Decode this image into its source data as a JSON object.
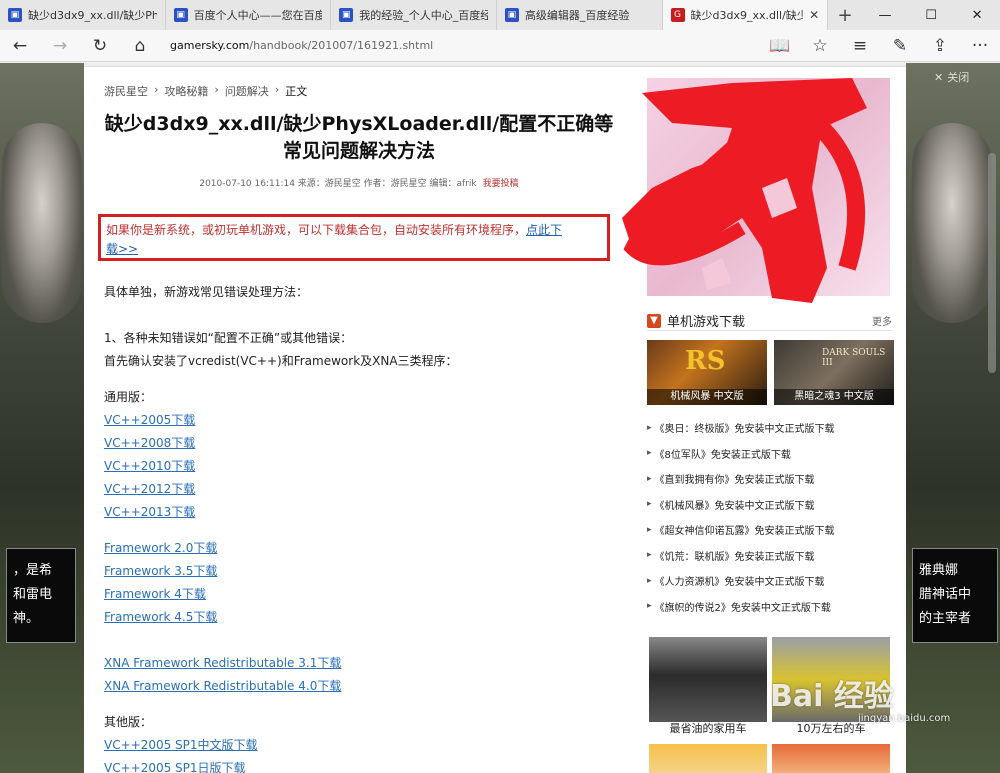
{
  "browser": {
    "tabs": [
      {
        "label": "缺少d3dx9_xx.dll/缺少PhysX",
        "active": false
      },
      {
        "label": "百度个人中心——您在百度",
        "active": false
      },
      {
        "label": "我的经验_个人中心_百度经",
        "active": false
      },
      {
        "label": "高级编辑器_百度经验",
        "active": false
      },
      {
        "label": "缺少d3dx9_xx.dll/缺少P",
        "active": true
      }
    ],
    "new_tab": "+",
    "window_controls": {
      "minimize": "—",
      "maximize": "☐",
      "close": "✕"
    },
    "url_host": "gamersky.com",
    "url_path": "/handbook/201007/161921.shtml",
    "nav_icons": {
      "back": "←",
      "forward": "→",
      "reload": "↻",
      "home": "⌂"
    },
    "toolbar_icons": {
      "reading": "📖",
      "favorite": "☆",
      "hub": "≡",
      "note": "✎",
      "share": "⇪",
      "more": "···"
    }
  },
  "ad": {
    "close_label": "关闭"
  },
  "article": {
    "breadcrumb": [
      "游民星空",
      "攻略秘籍",
      "问题解决",
      "正文"
    ],
    "title_line1": "缺少d3dx9_xx.dll/缺少PhysXLoader.dll/配置不正确等",
    "title_line2": "常见问题解决方法",
    "meta": "2010-07-10 16:11:14 来源：游民星空 作者：游民星空 编辑：afrik",
    "contribute": "我要投稿",
    "notice_text": "如果你是新系统，或初玩单机游戏，可以下载集合包，自动安装所有环境程序，",
    "notice_link_1": "点此下",
    "notice_link_2": "载>>",
    "intro": "具体单独，新游戏常见错误处理方法：",
    "section1_line1": "1、各种未知错误如“配置不正确”或其他错误：",
    "section1_line2": "首先确认安装了vcredist(VC++)和Framework及XNA三类程序：",
    "general_label": "通用版：",
    "vc_links": [
      "VC++2005下载",
      "VC++2008下载",
      "VC++2010下载",
      "VC++2012下载",
      "VC++2013下载"
    ],
    "framework_links": [
      "Framework 2.0下载",
      "Framework 3.5下载",
      "Framework 4下载",
      "Framework 4.5下载"
    ],
    "xna_links": [
      "XNA Framework Redistributable 3.1下载",
      "XNA Framework Redistributable 4.0下载"
    ],
    "other_label": "其他版：",
    "other_links": [
      "VC++2005 SP1中文版下载",
      "VC++2005 SP1日版下载"
    ]
  },
  "sidebar": {
    "section_title": "单机游戏下载",
    "more": "更多",
    "thumbs": [
      {
        "logo": "RS",
        "caption": "机械风暴 中文版"
      },
      {
        "logo": "DARK SOULS III",
        "caption": "黑暗之魂3 中文版"
      }
    ],
    "games": [
      "《奥日：终极版》免安装中文正式版下载",
      "《8位军队》免安装正式版下载",
      "《直到我拥有你》免安装正式版下载",
      "《机械风暴》免安装中文正式版下载",
      "《超女神信仰诺瓦露》免安装正式版下载",
      "《饥荒：联机版》免安装正式版下载",
      "《人力资源机》免安装中文正式版下载",
      "《旗帜的传说2》免安装中文正式版下载"
    ],
    "cars": [
      "最省油的家用车",
      "10万左右的车"
    ]
  },
  "background": {
    "left_promo": "，是希\n和雷电\n神。",
    "right_promo": "雅典娜\n腊神话中\n的主宰者"
  },
  "watermark": {
    "main": "Bai 经验",
    "sub": "jingyan.baidu.com"
  },
  "colors": {
    "accent_red": "#d42020",
    "link_blue": "#2a6fb8",
    "section_orange": "#d5481e"
  }
}
